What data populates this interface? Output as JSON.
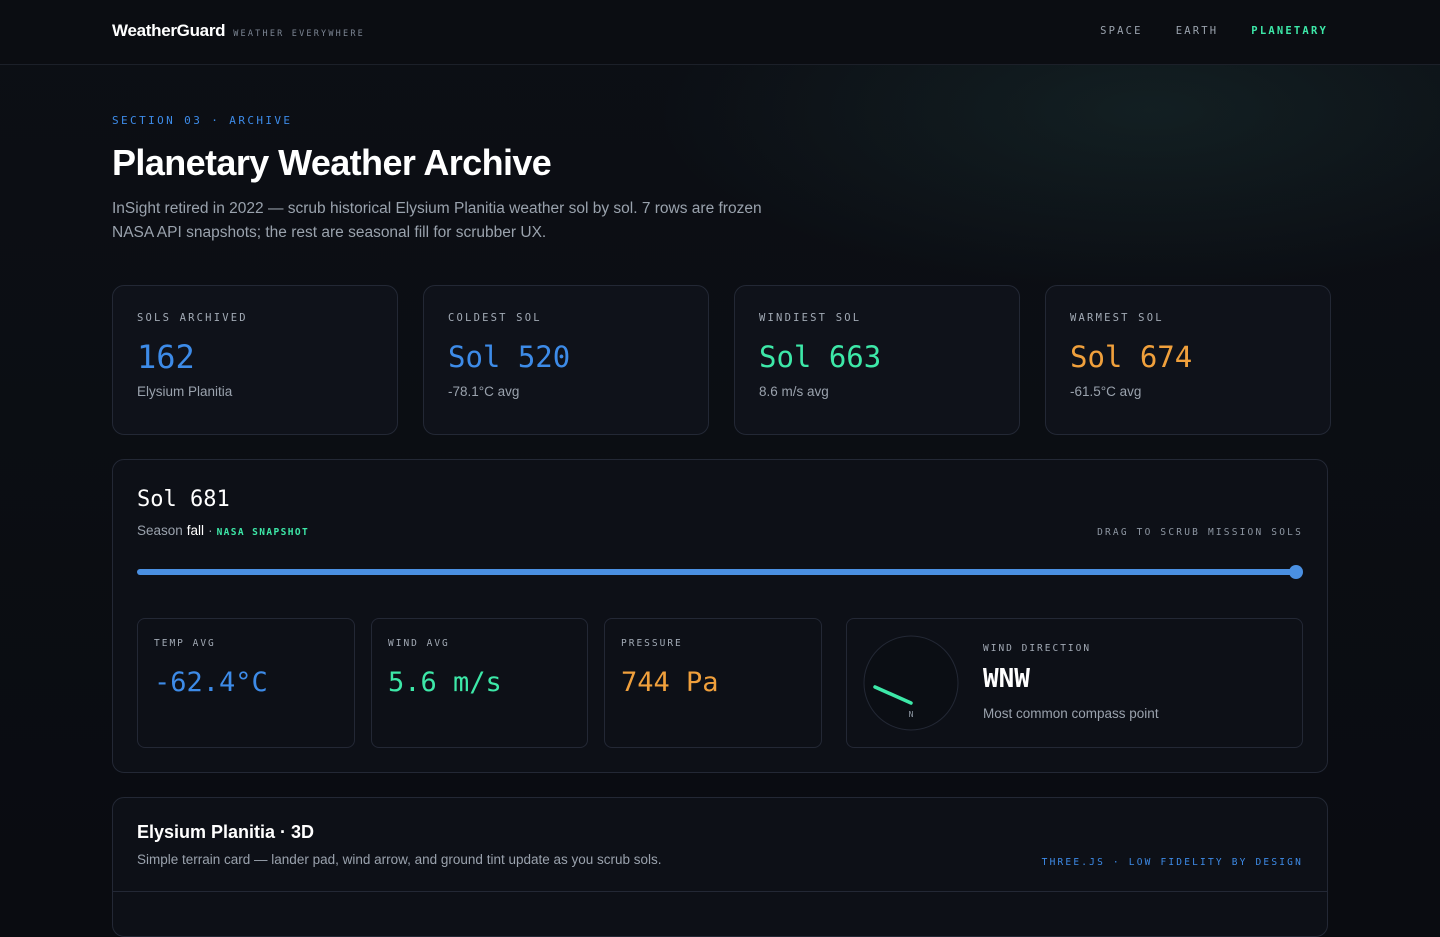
{
  "header": {
    "brand": "WeatherGuard",
    "tagline": "WEATHER EVERYWHERE",
    "nav": [
      {
        "label": "SPACE",
        "active": false
      },
      {
        "label": "EARTH",
        "active": false
      },
      {
        "label": "PLANETARY",
        "active": true
      }
    ]
  },
  "intro": {
    "eyebrow": "SECTION 03 · ARCHIVE",
    "title": "Planetary Weather Archive",
    "description": "InSight retired in 2022 — scrub historical Elysium Planitia weather sol by sol. 7 rows are frozen NASA API snapshots; the rest are seasonal fill for scrubber UX."
  },
  "stats": [
    {
      "label": "SOLS ARCHIVED",
      "value": "162",
      "sub": "Elysium Planitia",
      "color": "#3d8be8"
    },
    {
      "label": "COLDEST SOL",
      "value": "Sol 520",
      "sub": "-78.1°C avg",
      "color": "#3d8be8"
    },
    {
      "label": "WINDIEST SOL",
      "value": "Sol 663",
      "sub": "8.6 m/s avg",
      "color": "#3de8a8"
    },
    {
      "label": "WARMEST SOL",
      "value": "Sol 674",
      "sub": "-61.5°C avg",
      "color": "#f0a03c"
    }
  ],
  "sol_viewer": {
    "title": "Sol 681",
    "season_prefix": "Season",
    "season": "fall",
    "separator": "·",
    "snapshot_badge": "NASA SNAPSHOT",
    "drag_hint": "DRAG TO SCRUB MISSION SOLS",
    "slider_position": 1.0,
    "metrics": [
      {
        "label": "TEMP AVG",
        "value": "-62.4°C",
        "color": "#3d8be8"
      },
      {
        "label": "WIND AVG",
        "value": "5.6 m/s",
        "color": "#3de8a8"
      },
      {
        "label": "PRESSURE",
        "value": "744 Pa",
        "color": "#f0a03c"
      }
    ],
    "wind_direction": {
      "label": "WIND DIRECTION",
      "value": "WNW",
      "sub": "Most common compass point",
      "compass_north": "N",
      "needle_color": "#3de8a8"
    }
  },
  "terrain": {
    "title": "Elysium Planitia · 3D",
    "description": "Simple terrain card — lander pad, wind arrow, and ground tint update as you scrub sols.",
    "tag": "THREE.JS · LOW FIDELITY BY DESIGN"
  }
}
